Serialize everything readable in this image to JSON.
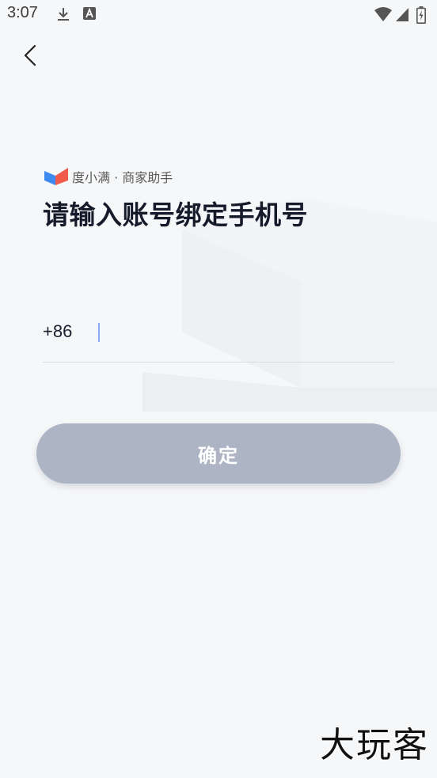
{
  "status_bar": {
    "time": "3:07",
    "left_icons": [
      "download-icon",
      "a-badge-icon"
    ],
    "right_icons": [
      "wifi-icon",
      "signal-icon",
      "battery-icon"
    ]
  },
  "nav": {
    "back_icon": "chevron-left-icon"
  },
  "brand": {
    "text": "度小满 · 商家助手",
    "colors": {
      "blue": "#3d8bf0",
      "red": "#f05a4a"
    }
  },
  "title": "请输入账号绑定手机号",
  "phone": {
    "country_code": "+86",
    "value": "",
    "placeholder": ""
  },
  "confirm": {
    "label": "确定",
    "color": "#adb4c3"
  },
  "watermark": "大玩客"
}
